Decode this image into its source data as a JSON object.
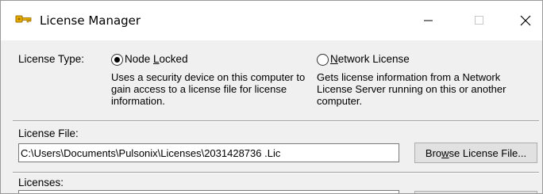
{
  "window": {
    "title": "License Manager",
    "icon": "key-icon"
  },
  "controls": {
    "minimize_label": "—",
    "maximize_label": "☐",
    "close_label": "✕"
  },
  "license_type": {
    "label": "License Type:",
    "options": [
      {
        "label_pre": "Node ",
        "label_mnemonic": "L",
        "label_post": "ocked",
        "selected": true,
        "description": "Uses a security device on this computer to gain access to a license file for license information."
      },
      {
        "label_pre": "",
        "label_mnemonic": "N",
        "label_post": "etwork License",
        "selected": false,
        "description": "Gets license information from a Network License Server running on this or another computer."
      }
    ]
  },
  "license_file": {
    "label": "License File:",
    "value": "C:\\Users\\Documents\\Pulsonix\\Licenses\\2031428736 .Lic",
    "browse_pre": "Bro",
    "browse_mnemonic": "w",
    "browse_post": "se License File..."
  },
  "licenses": {
    "label": "Licenses:"
  }
}
